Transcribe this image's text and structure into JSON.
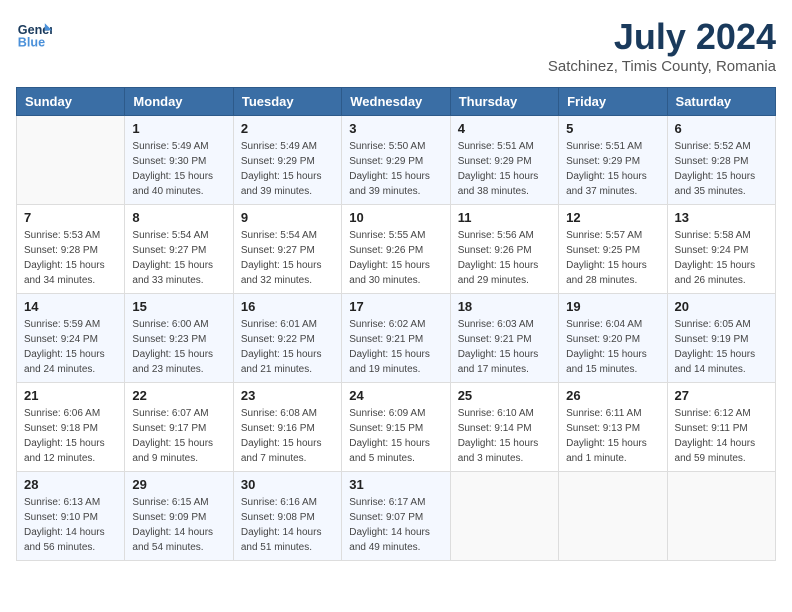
{
  "header": {
    "logo_line1": "General",
    "logo_line2": "Blue",
    "title": "July 2024",
    "subtitle": "Satchinez, Timis County, Romania"
  },
  "weekdays": [
    "Sunday",
    "Monday",
    "Tuesday",
    "Wednesday",
    "Thursday",
    "Friday",
    "Saturday"
  ],
  "weeks": [
    [
      {
        "day": "",
        "sunrise": "",
        "sunset": "",
        "daylight": ""
      },
      {
        "day": "1",
        "sunrise": "Sunrise: 5:49 AM",
        "sunset": "Sunset: 9:30 PM",
        "daylight": "Daylight: 15 hours and 40 minutes."
      },
      {
        "day": "2",
        "sunrise": "Sunrise: 5:49 AM",
        "sunset": "Sunset: 9:29 PM",
        "daylight": "Daylight: 15 hours and 39 minutes."
      },
      {
        "day": "3",
        "sunrise": "Sunrise: 5:50 AM",
        "sunset": "Sunset: 9:29 PM",
        "daylight": "Daylight: 15 hours and 39 minutes."
      },
      {
        "day": "4",
        "sunrise": "Sunrise: 5:51 AM",
        "sunset": "Sunset: 9:29 PM",
        "daylight": "Daylight: 15 hours and 38 minutes."
      },
      {
        "day": "5",
        "sunrise": "Sunrise: 5:51 AM",
        "sunset": "Sunset: 9:29 PM",
        "daylight": "Daylight: 15 hours and 37 minutes."
      },
      {
        "day": "6",
        "sunrise": "Sunrise: 5:52 AM",
        "sunset": "Sunset: 9:28 PM",
        "daylight": "Daylight: 15 hours and 35 minutes."
      }
    ],
    [
      {
        "day": "7",
        "sunrise": "Sunrise: 5:53 AM",
        "sunset": "Sunset: 9:28 PM",
        "daylight": "Daylight: 15 hours and 34 minutes."
      },
      {
        "day": "8",
        "sunrise": "Sunrise: 5:54 AM",
        "sunset": "Sunset: 9:27 PM",
        "daylight": "Daylight: 15 hours and 33 minutes."
      },
      {
        "day": "9",
        "sunrise": "Sunrise: 5:54 AM",
        "sunset": "Sunset: 9:27 PM",
        "daylight": "Daylight: 15 hours and 32 minutes."
      },
      {
        "day": "10",
        "sunrise": "Sunrise: 5:55 AM",
        "sunset": "Sunset: 9:26 PM",
        "daylight": "Daylight: 15 hours and 30 minutes."
      },
      {
        "day": "11",
        "sunrise": "Sunrise: 5:56 AM",
        "sunset": "Sunset: 9:26 PM",
        "daylight": "Daylight: 15 hours and 29 minutes."
      },
      {
        "day": "12",
        "sunrise": "Sunrise: 5:57 AM",
        "sunset": "Sunset: 9:25 PM",
        "daylight": "Daylight: 15 hours and 28 minutes."
      },
      {
        "day": "13",
        "sunrise": "Sunrise: 5:58 AM",
        "sunset": "Sunset: 9:24 PM",
        "daylight": "Daylight: 15 hours and 26 minutes."
      }
    ],
    [
      {
        "day": "14",
        "sunrise": "Sunrise: 5:59 AM",
        "sunset": "Sunset: 9:24 PM",
        "daylight": "Daylight: 15 hours and 24 minutes."
      },
      {
        "day": "15",
        "sunrise": "Sunrise: 6:00 AM",
        "sunset": "Sunset: 9:23 PM",
        "daylight": "Daylight: 15 hours and 23 minutes."
      },
      {
        "day": "16",
        "sunrise": "Sunrise: 6:01 AM",
        "sunset": "Sunset: 9:22 PM",
        "daylight": "Daylight: 15 hours and 21 minutes."
      },
      {
        "day": "17",
        "sunrise": "Sunrise: 6:02 AM",
        "sunset": "Sunset: 9:21 PM",
        "daylight": "Daylight: 15 hours and 19 minutes."
      },
      {
        "day": "18",
        "sunrise": "Sunrise: 6:03 AM",
        "sunset": "Sunset: 9:21 PM",
        "daylight": "Daylight: 15 hours and 17 minutes."
      },
      {
        "day": "19",
        "sunrise": "Sunrise: 6:04 AM",
        "sunset": "Sunset: 9:20 PM",
        "daylight": "Daylight: 15 hours and 15 minutes."
      },
      {
        "day": "20",
        "sunrise": "Sunrise: 6:05 AM",
        "sunset": "Sunset: 9:19 PM",
        "daylight": "Daylight: 15 hours and 14 minutes."
      }
    ],
    [
      {
        "day": "21",
        "sunrise": "Sunrise: 6:06 AM",
        "sunset": "Sunset: 9:18 PM",
        "daylight": "Daylight: 15 hours and 12 minutes."
      },
      {
        "day": "22",
        "sunrise": "Sunrise: 6:07 AM",
        "sunset": "Sunset: 9:17 PM",
        "daylight": "Daylight: 15 hours and 9 minutes."
      },
      {
        "day": "23",
        "sunrise": "Sunrise: 6:08 AM",
        "sunset": "Sunset: 9:16 PM",
        "daylight": "Daylight: 15 hours and 7 minutes."
      },
      {
        "day": "24",
        "sunrise": "Sunrise: 6:09 AM",
        "sunset": "Sunset: 9:15 PM",
        "daylight": "Daylight: 15 hours and 5 minutes."
      },
      {
        "day": "25",
        "sunrise": "Sunrise: 6:10 AM",
        "sunset": "Sunset: 9:14 PM",
        "daylight": "Daylight: 15 hours and 3 minutes."
      },
      {
        "day": "26",
        "sunrise": "Sunrise: 6:11 AM",
        "sunset": "Sunset: 9:13 PM",
        "daylight": "Daylight: 15 hours and 1 minute."
      },
      {
        "day": "27",
        "sunrise": "Sunrise: 6:12 AM",
        "sunset": "Sunset: 9:11 PM",
        "daylight": "Daylight: 14 hours and 59 minutes."
      }
    ],
    [
      {
        "day": "28",
        "sunrise": "Sunrise: 6:13 AM",
        "sunset": "Sunset: 9:10 PM",
        "daylight": "Daylight: 14 hours and 56 minutes."
      },
      {
        "day": "29",
        "sunrise": "Sunrise: 6:15 AM",
        "sunset": "Sunset: 9:09 PM",
        "daylight": "Daylight: 14 hours and 54 minutes."
      },
      {
        "day": "30",
        "sunrise": "Sunrise: 6:16 AM",
        "sunset": "Sunset: 9:08 PM",
        "daylight": "Daylight: 14 hours and 51 minutes."
      },
      {
        "day": "31",
        "sunrise": "Sunrise: 6:17 AM",
        "sunset": "Sunset: 9:07 PM",
        "daylight": "Daylight: 14 hours and 49 minutes."
      },
      {
        "day": "",
        "sunrise": "",
        "sunset": "",
        "daylight": ""
      },
      {
        "day": "",
        "sunrise": "",
        "sunset": "",
        "daylight": ""
      },
      {
        "day": "",
        "sunrise": "",
        "sunset": "",
        "daylight": ""
      }
    ]
  ]
}
